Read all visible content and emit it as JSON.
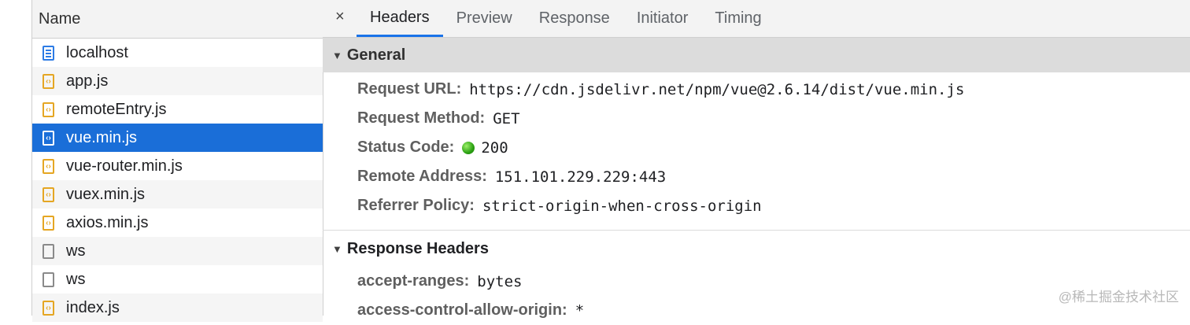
{
  "name_header": "Name",
  "requests": [
    {
      "name": "localhost",
      "icon": "document-icon"
    },
    {
      "name": "app.js",
      "icon": "script-icon"
    },
    {
      "name": "remoteEntry.js",
      "icon": "script-icon"
    },
    {
      "name": "vue.min.js",
      "icon": "script-icon",
      "selected": true
    },
    {
      "name": "vue-router.min.js",
      "icon": "script-icon"
    },
    {
      "name": "vuex.min.js",
      "icon": "script-icon"
    },
    {
      "name": "axios.min.js",
      "icon": "script-icon"
    },
    {
      "name": "ws",
      "icon": "blank-file-icon"
    },
    {
      "name": "ws",
      "icon": "blank-file-icon"
    },
    {
      "name": "index.js",
      "icon": "script-icon"
    }
  ],
  "tabs": {
    "close": "×",
    "headers": "Headers",
    "preview": "Preview",
    "response": "Response",
    "initiator": "Initiator",
    "timing": "Timing",
    "active": "Headers"
  },
  "general": {
    "title": "General",
    "request_url_label": "Request URL:",
    "request_url": "https://cdn.jsdelivr.net/npm/vue@2.6.14/dist/vue.min.js",
    "request_method_label": "Request Method:",
    "request_method": "GET",
    "status_code_label": "Status Code:",
    "status_code": "200",
    "status_color": "#2aa012",
    "remote_address_label": "Remote Address:",
    "remote_address": "151.101.229.229:443",
    "referrer_policy_label": "Referrer Policy:",
    "referrer_policy": "strict-origin-when-cross-origin"
  },
  "response_headers": {
    "title": "Response Headers",
    "accept_ranges_label": "accept-ranges:",
    "accept_ranges": "bytes",
    "acao_label": "access-control-allow-origin:",
    "acao": "*"
  },
  "watermark": "@稀土掘金技术社区",
  "colors": {
    "accent": "#1a73e8",
    "selected_row": "#1a6ed8"
  }
}
